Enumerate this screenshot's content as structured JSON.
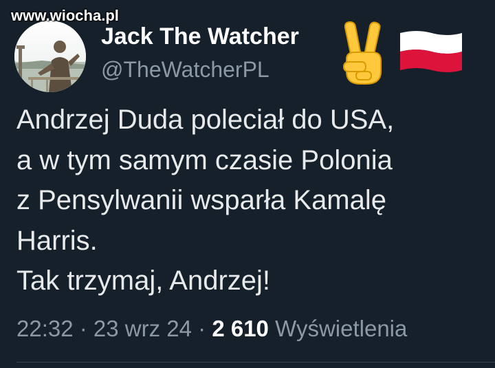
{
  "watermark": "www.wiocha.pl",
  "author": {
    "name": "Jack The Watcher",
    "handle": "@TheWatcherPL",
    "avatar_icon": "profile-photo",
    "name_emoji": [
      "victory-hand-icon",
      "poland-flag-icon"
    ]
  },
  "tweet": {
    "lines": [
      "Andrzej Duda poleciał do USA,",
      "a w tym samym czasie Polonia",
      "z Pensylwanii wsparła Kamalę",
      "Harris.",
      "Tak trzymaj, Andrzej!"
    ]
  },
  "meta": {
    "time": "22:32",
    "separator": " · ",
    "date": "23 wrz 24",
    "views_count": "2 610",
    "views_label": "Wyświetlenia"
  },
  "colors": {
    "background": "#15202b",
    "text": "#e7e9ea",
    "secondary": "#8b98a5",
    "flag_white": "#ffffff",
    "flag_red": "#dc143c",
    "emoji_yellow": "#ffc83d"
  }
}
